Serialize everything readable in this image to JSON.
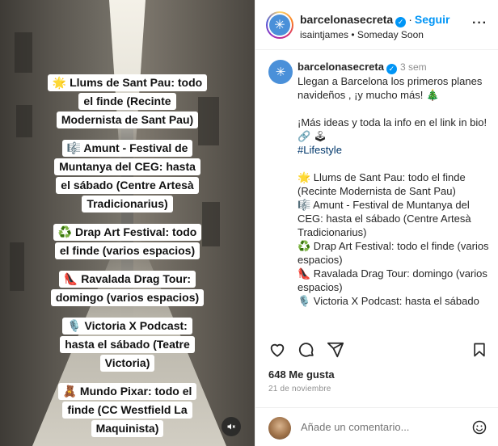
{
  "media": {
    "overlay_items": [
      {
        "lines": [
          "🌟 Llums de Sant Pau: todo",
          "el finde (Recinte",
          "Modernista de Sant Pau)"
        ]
      },
      {
        "lines": [
          "🎼 Amunt - Festival de",
          "Muntanya del CEG: hasta",
          "el sábado (Centre Artesà",
          "Tradicionarius)"
        ]
      },
      {
        "lines": [
          "♻️ Drap Art Festival: todo",
          "el finde (varios espacios)"
        ]
      },
      {
        "lines": [
          "👠 Ravalada Drag Tour:",
          "domingo (varios espacios)"
        ]
      },
      {
        "lines": [
          "🎙️ Victoria X Podcast:",
          "hasta el sábado (Teatre",
          "Victoria)"
        ]
      },
      {
        "lines": [
          "🧸 Mundo Pixar: todo el",
          "finde (CC Westfield La",
          "Maquinista)"
        ]
      }
    ]
  },
  "header": {
    "username": "barcelonasecreta",
    "follow_label": "Seguir",
    "subtitle": "isaintjames • Someday Soon"
  },
  "caption": {
    "username": "barcelonasecreta",
    "time": "3 sem",
    "intro": "Llegan a Barcelona los primeros planes navideños , ¡y mucho más! 🎄",
    "more_info": "¡Más ideas y toda la info en el link in bio! 🔗 🕹",
    "hashtag": "#Lifestyle",
    "items": [
      "🌟 Llums de Sant Pau: todo el finde (Recinte Modernista de Sant Pau)",
      "🎼 Amunt - Festival de Muntanya del CEG: hasta el sábado (Centre Artesà Tradicionarius)",
      "♻️ Drap Art Festival: todo el finde (varios espacios)",
      "👠 Ravalada Drag Tour: domingo (varios espacios)",
      "🎙️ Victoria X Podcast: hasta el sábado (Teatre Victoria)",
      "🧸 Mundo Pixar: todo el finde (CC"
    ]
  },
  "stats": {
    "likes": "648 Me gusta",
    "date": "21 de noviembre"
  },
  "comment": {
    "placeholder": "Añade un comentario..."
  },
  "colors": {
    "follow": "#0095f6",
    "verified": "#0095f6",
    "hashtag": "#00376b"
  },
  "icons": [
    "heart-icon",
    "comment-icon",
    "share-icon",
    "bookmark-icon",
    "more-icon",
    "mute-icon",
    "emoji-icon",
    "verified-icon"
  ]
}
